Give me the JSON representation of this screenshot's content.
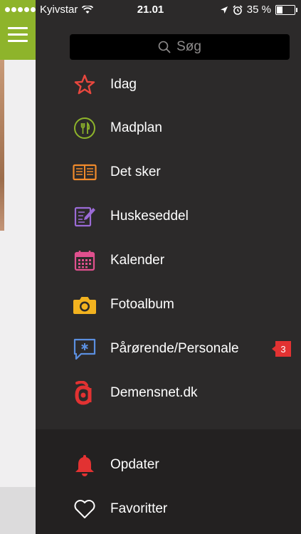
{
  "status": {
    "carrier": "Kyivstar",
    "time": "21.01",
    "battery": "35 %"
  },
  "search": {
    "placeholder": "Søg"
  },
  "menu": [
    {
      "label": "Idag",
      "icon": "star-icon",
      "color": "#e8473e"
    },
    {
      "label": "Madplan",
      "icon": "fork-knife-icon",
      "color": "#8eb42b"
    },
    {
      "label": "Det sker",
      "icon": "open-book-icon",
      "color": "#f08a2b"
    },
    {
      "label": "Huskeseddel",
      "icon": "notepad-pencil-icon",
      "color": "#9b6bd6"
    },
    {
      "label": "Kalender",
      "icon": "calendar-icon",
      "color": "#e0508e"
    },
    {
      "label": "Fotoalbum",
      "icon": "camera-icon",
      "color": "#f2b21f"
    },
    {
      "label": "Pårørende/Personale",
      "icon": "chat-bubble-icon",
      "color": "#5b8fe0",
      "badge": "3"
    },
    {
      "label": "Demensnet.dk",
      "icon": "demensnet-logo-icon",
      "color": "#e23232"
    }
  ],
  "bottom_menu": [
    {
      "label": "Opdater",
      "icon": "bell-icon",
      "color": "#e23232"
    },
    {
      "label": "Favoritter",
      "icon": "heart-outline-icon",
      "color": "#ffffff"
    }
  ],
  "colors": {
    "hamburger_bg": "#8eb42b",
    "menu_bg": "#2c2a2a",
    "badge": "#e23232"
  }
}
